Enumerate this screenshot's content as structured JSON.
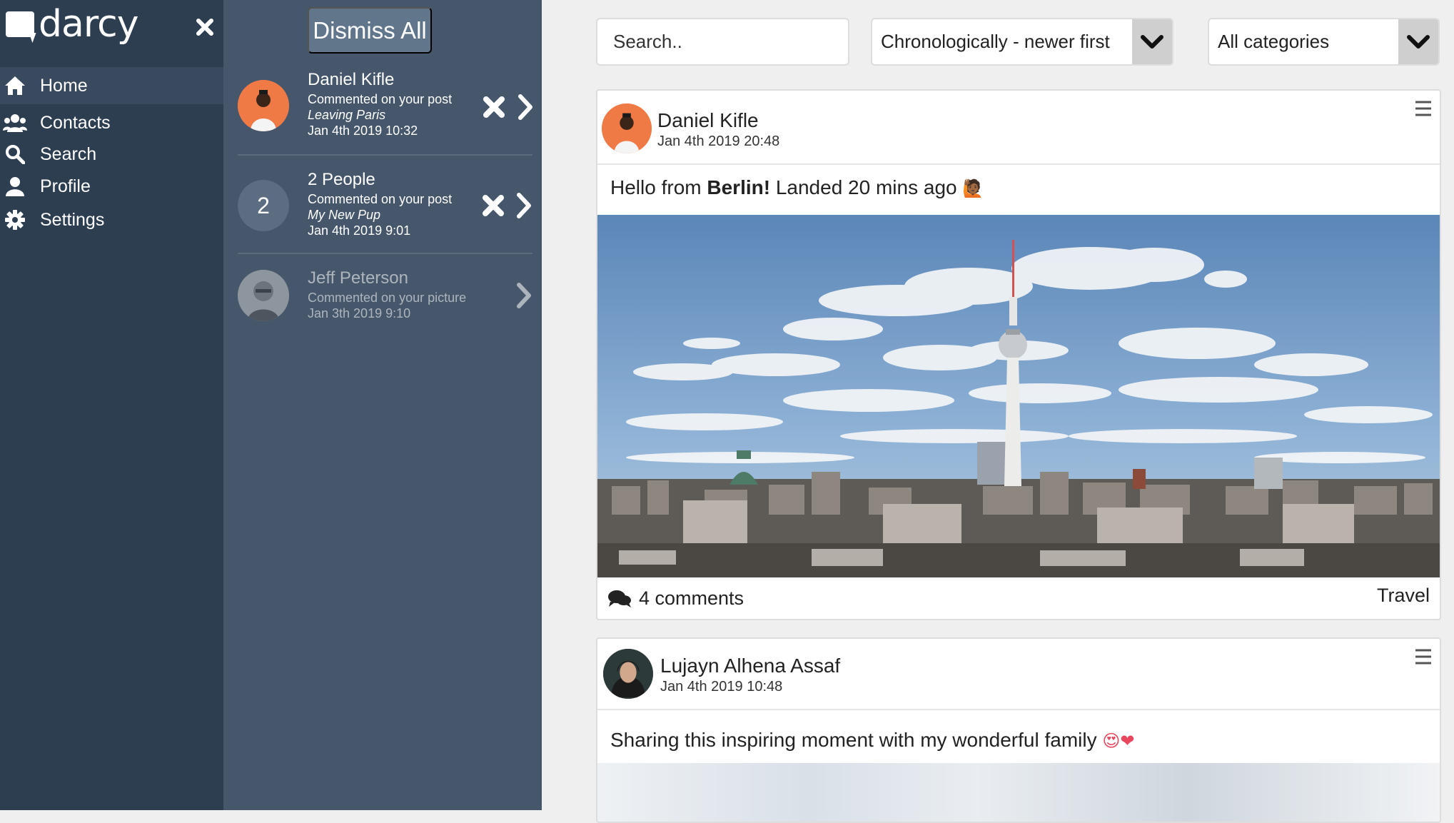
{
  "app": {
    "name": "darcy"
  },
  "sidebar": {
    "items": [
      {
        "label": "Home",
        "icon": "home-icon"
      },
      {
        "label": "Contacts",
        "icon": "contacts-icon"
      },
      {
        "label": "Search",
        "icon": "search-icon"
      },
      {
        "label": "Profile",
        "icon": "profile-icon"
      },
      {
        "label": "Settings",
        "icon": "gear-icon"
      }
    ]
  },
  "notifications": {
    "dismiss_label": "Dismiss All",
    "items": [
      {
        "title": "Daniel Kifle",
        "action": "Commented on your post",
        "subject": "Leaving Paris",
        "date": "Jan 4th 2019 10:32"
      },
      {
        "count": "2",
        "title": "2 People",
        "action": "Commented on your post",
        "subject": "My New Pup",
        "date": "Jan 4th 2019 9:01"
      },
      {
        "title": "Jeff Peterson",
        "action": "Commented on your picture",
        "date": "Jan 3th 2019 9:10"
      }
    ]
  },
  "toolbar": {
    "search_placeholder": "Search..",
    "sort_value": "Chronologically - newer first",
    "category_value": "All categories"
  },
  "posts": [
    {
      "author": "Daniel Kifle",
      "date": "Jan 4th 2019 20:48",
      "text_before": "Hello from ",
      "text_bold": "Berlin!",
      "text_after": " Landed 20 mins ago",
      "emoji": "🙋🏾",
      "comments": "4 comments",
      "category": "Travel"
    },
    {
      "author": "Lujayn Alhena Assaf",
      "date": "Jan 4th 2019 10:48",
      "text": "Sharing this inspiring moment with my wonderful family",
      "emoji": "😍❤"
    }
  ],
  "colors": {
    "sidebar_bg": "#2e3e51",
    "notifications_bg": "#46576c",
    "accent_avatar": "#f07a45",
    "main_bg": "#efefef"
  }
}
